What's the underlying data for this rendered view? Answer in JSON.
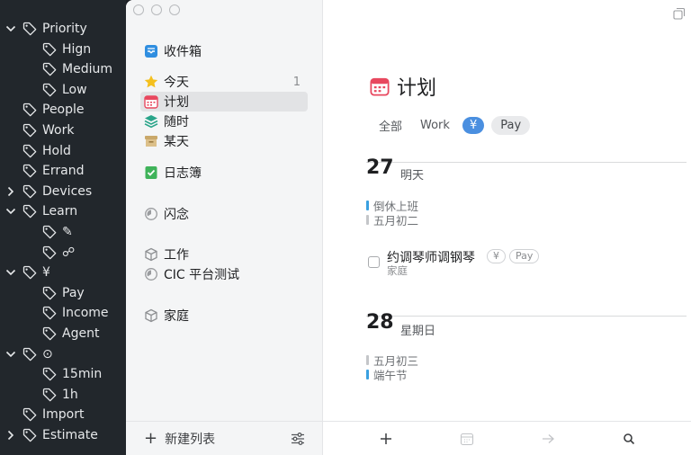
{
  "tag_panel": {
    "items": [
      {
        "label": "Priority",
        "level": 0,
        "chevron": "down"
      },
      {
        "label": "Hign",
        "level": 1,
        "chevron": "none"
      },
      {
        "label": "Medium",
        "level": 1,
        "chevron": "none"
      },
      {
        "label": "Low",
        "level": 1,
        "chevron": "none"
      },
      {
        "label": "People",
        "level": 0,
        "chevron": "none"
      },
      {
        "label": "Work",
        "level": 0,
        "chevron": "none"
      },
      {
        "label": "Hold",
        "level": 0,
        "chevron": "none"
      },
      {
        "label": "Errand",
        "level": 0,
        "chevron": "none"
      },
      {
        "label": "Devices",
        "level": 0,
        "chevron": "right"
      },
      {
        "label": "Learn",
        "level": 0,
        "chevron": "down"
      },
      {
        "label": "✎",
        "level": 1,
        "chevron": "none"
      },
      {
        "label": "☍",
        "level": 1,
        "chevron": "none"
      },
      {
        "label": "¥",
        "level": 0,
        "chevron": "down"
      },
      {
        "label": "Pay",
        "level": 1,
        "chevron": "none"
      },
      {
        "label": "Income",
        "level": 1,
        "chevron": "none"
      },
      {
        "label": "Agent",
        "level": 1,
        "chevron": "none"
      },
      {
        "label": "⊙",
        "level": 0,
        "chevron": "down"
      },
      {
        "label": "15min",
        "level": 1,
        "chevron": "none"
      },
      {
        "label": "1h",
        "level": 1,
        "chevron": "none"
      },
      {
        "label": "Import",
        "level": 0,
        "chevron": "none"
      },
      {
        "label": "Estimate",
        "level": 0,
        "chevron": "right"
      }
    ]
  },
  "sidebar": {
    "inbox": {
      "label": "收件箱",
      "icon": "inbox-icon"
    },
    "today": {
      "label": "今天",
      "icon": "star-icon",
      "count": "1"
    },
    "plan": {
      "label": "计划",
      "icon": "calendar-icon"
    },
    "anytime": {
      "label": "随时",
      "icon": "layers-icon"
    },
    "someday": {
      "label": "某天",
      "icon": "box-icon"
    },
    "logbook": {
      "label": "日志簿",
      "icon": "logbook-icon"
    },
    "flash": {
      "label": "闪念",
      "icon": "progress-circle-icon"
    },
    "area_work": {
      "label": "工作",
      "icon": "cube-icon"
    },
    "project_cic": {
      "label": "CIC 平台测试",
      "icon": "progress-circle-icon"
    },
    "area_home": {
      "label": "家庭",
      "icon": "cube-icon"
    },
    "new_list": "新建列表"
  },
  "main": {
    "title": "计划",
    "filters": {
      "all": "全部",
      "work": "Work",
      "yen": "¥",
      "pay": "Pay"
    },
    "days": [
      {
        "num": "27",
        "name": "明天",
        "notes": [
          "倒休上班",
          "五月初二"
        ]
      },
      {
        "num": "28",
        "name": "星期日",
        "notes": [
          "五月初三",
          "端午节"
        ]
      }
    ],
    "task": {
      "title": "约调琴师调钢琴",
      "area": "家庭",
      "tags": [
        "¥",
        "Pay"
      ]
    }
  },
  "colors": {
    "accent": "#4a8fe0",
    "note_blue": "#3aa0e0",
    "note_gray": "#c4c6c9",
    "calendar_red": "#e8485f"
  }
}
